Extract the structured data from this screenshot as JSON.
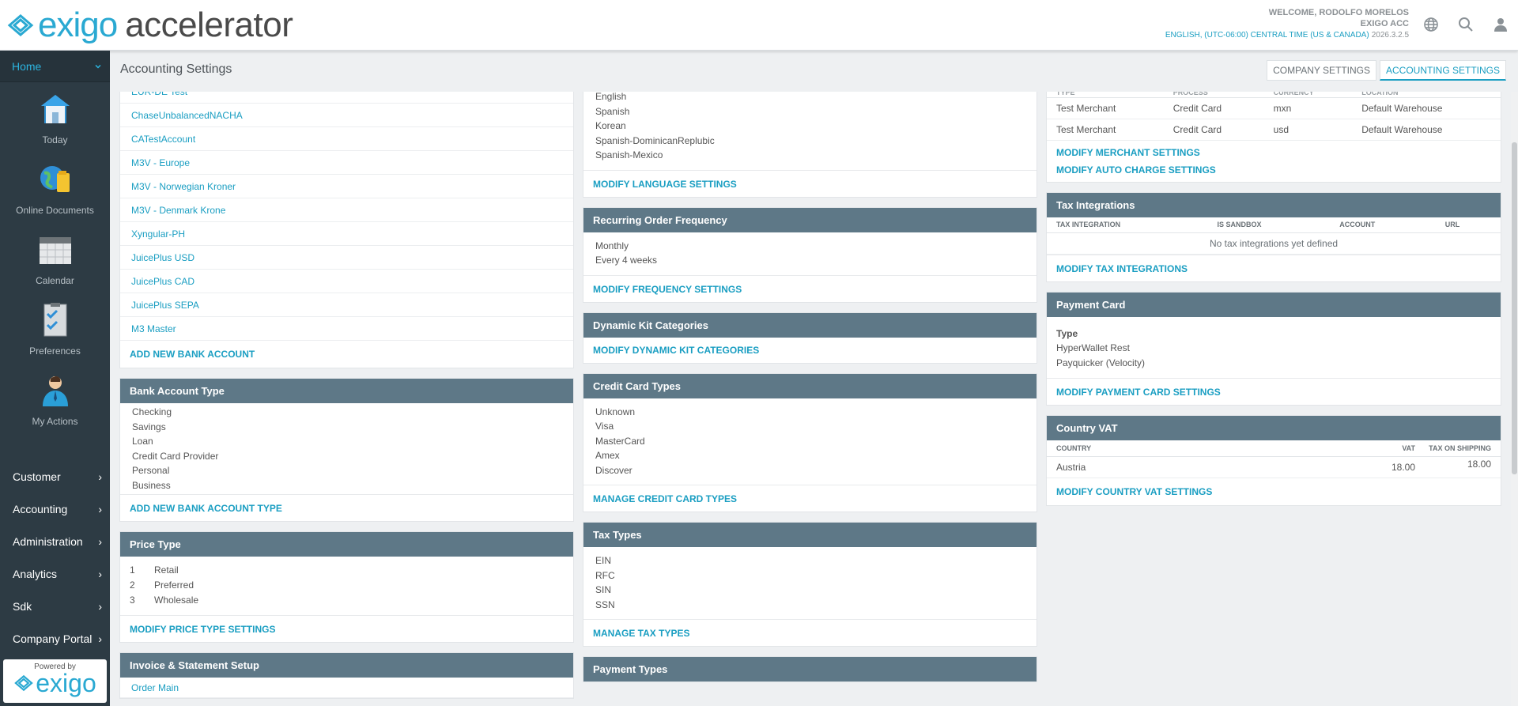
{
  "header": {
    "logo_text": "exigo",
    "app_name": "accelerator",
    "welcome": "WELCOME, RODOLFO MORELOS",
    "company": "EXIGO ACC",
    "locale": "ENGLISH, (UTC-06:00) CENTRAL TIME (US & CANADA)",
    "version": "2026.3.2.5",
    "icons": [
      "globe-icon",
      "search-icon",
      "user-icon"
    ]
  },
  "sidebar": {
    "home_label": "Home",
    "apps": [
      {
        "label": "Today",
        "icon": "house-icon"
      },
      {
        "label": "Online Documents",
        "icon": "globe-folder-icon"
      },
      {
        "label": "Calendar",
        "icon": "calendar-icon"
      },
      {
        "label": "Preferences",
        "icon": "checklist-icon"
      },
      {
        "label": "My Actions",
        "icon": "person-icon"
      }
    ],
    "menu": [
      "Customer",
      "Accounting",
      "Administration",
      "Analytics",
      "Sdk",
      "Company Portal"
    ],
    "powered_by": "Powered by",
    "powered_logo": "exigo"
  },
  "page": {
    "title": "Accounting Settings",
    "tabs": [
      {
        "label": "COMPANY SETTINGS",
        "active": false
      },
      {
        "label": "ACCOUNTING SETTINGS",
        "active": true
      }
    ]
  },
  "col1": {
    "bank_accounts": [
      "EUR-DE Test",
      "ChaseUnbalancedNACHA",
      "CATestAccount",
      "M3V - Europe",
      "M3V - Norwegian Kroner",
      "M3V - Denmark Krone",
      "Xyngular-PH",
      "JuicePlus USD",
      "JuicePlus CAD",
      "JuicePlus SEPA",
      "M3 Master"
    ],
    "add_bank_account": "ADD NEW BANK ACCOUNT",
    "bank_account_type": {
      "title": "Bank Account Type",
      "items": [
        "Checking",
        "Savings",
        "Loan",
        "Credit Card Provider",
        "Personal",
        "Business"
      ],
      "action": "ADD NEW BANK ACCOUNT TYPE"
    },
    "price_type": {
      "title": "Price Type",
      "items": [
        {
          "id": "1",
          "name": "Retail"
        },
        {
          "id": "2",
          "name": "Preferred"
        },
        {
          "id": "3",
          "name": "Wholesale"
        }
      ],
      "action": "MODIFY PRICE TYPE SETTINGS"
    },
    "invoice": {
      "title": "Invoice & Statement Setup",
      "items": [
        "Order Main"
      ]
    }
  },
  "col2": {
    "languages": [
      "English",
      "Spanish",
      "Korean",
      "Spanish-DominicanReplubic",
      "Spanish-Mexico"
    ],
    "language_action": "MODIFY LANGUAGE SETTINGS",
    "recurring": {
      "title": "Recurring Order Frequency",
      "items": [
        "Monthly",
        "Every 4 weeks"
      ],
      "action": "MODIFY FREQUENCY SETTINGS"
    },
    "dynamic_kit": {
      "title": "Dynamic Kit Categories",
      "action": "MODIFY DYNAMIC KIT CATEGORIES"
    },
    "credit_card_types": {
      "title": "Credit Card Types",
      "items": [
        "Unknown",
        "Visa",
        "MasterCard",
        "Amex",
        "Discover"
      ],
      "action": "MANAGE CREDIT CARD TYPES"
    },
    "tax_types": {
      "title": "Tax Types",
      "items": [
        "EIN",
        "RFC",
        "SIN",
        "SSN"
      ],
      "action": "MANAGE TAX TYPES"
    },
    "payment_types": {
      "title": "Payment Types"
    }
  },
  "col3": {
    "merchants": {
      "columns": [
        "TYPE",
        "PROCESS",
        "CURRENCY",
        "LOCATION"
      ],
      "rows": [
        [
          "Test Merchant",
          "Credit Card",
          "mxn",
          "Default Warehouse"
        ],
        [
          "Test Merchant",
          "Credit Card",
          "usd",
          "Default Warehouse"
        ]
      ],
      "action1": "MODIFY MERCHANT SETTINGS",
      "action2": "MODIFY AUTO CHARGE SETTINGS"
    },
    "tax_integrations": {
      "title": "Tax Integrations",
      "columns": [
        "TAX INTEGRATION",
        "IS SANDBOX",
        "ACCOUNT",
        "URL"
      ],
      "empty": "No tax integrations yet defined",
      "action": "MODIFY TAX INTEGRATIONS"
    },
    "payment_card": {
      "title": "Payment Card",
      "type_label": "Type",
      "items": [
        "HyperWallet Rest",
        "Payquicker (Velocity)"
      ],
      "action": "MODIFY PAYMENT CARD SETTINGS"
    },
    "country_vat": {
      "title": "Country VAT",
      "columns": [
        "COUNTRY",
        "VAT",
        "TAX ON SHIPPING"
      ],
      "rows": [
        [
          "Austria",
          "18.00",
          "18.00"
        ]
      ],
      "action": "MODIFY COUNTRY VAT SETTINGS"
    }
  }
}
